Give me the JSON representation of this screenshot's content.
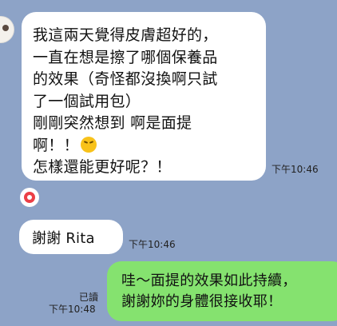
{
  "chat": {
    "incoming": [
      {
        "lines": [
          "我這兩天覺得皮膚超好的，",
          "一直在想是擦了哪個保養品",
          "的效果（奇怪都沒換啊只試",
          "了一個試用包）",
          "剛剛突然想到 啊是面提",
          "啊！！",
          "怎樣還能更好呢？！"
        ],
        "emoji": "laughing-crying-face-icon",
        "time": "下午10:46"
      },
      {
        "text": "謝謝 Rita",
        "time": "下午10:46"
      }
    ],
    "outgoing": {
      "lines": [
        "哇～面提的效果如此持續，",
        "謝謝妳的身體很接收耶！"
      ],
      "read_status": "已讀",
      "time": "下午10:48"
    }
  },
  "colors": {
    "background": "#8da3c7",
    "incoming_bubble": "#ffffff",
    "outgoing_bubble": "#85e26f",
    "text": "#111111"
  }
}
